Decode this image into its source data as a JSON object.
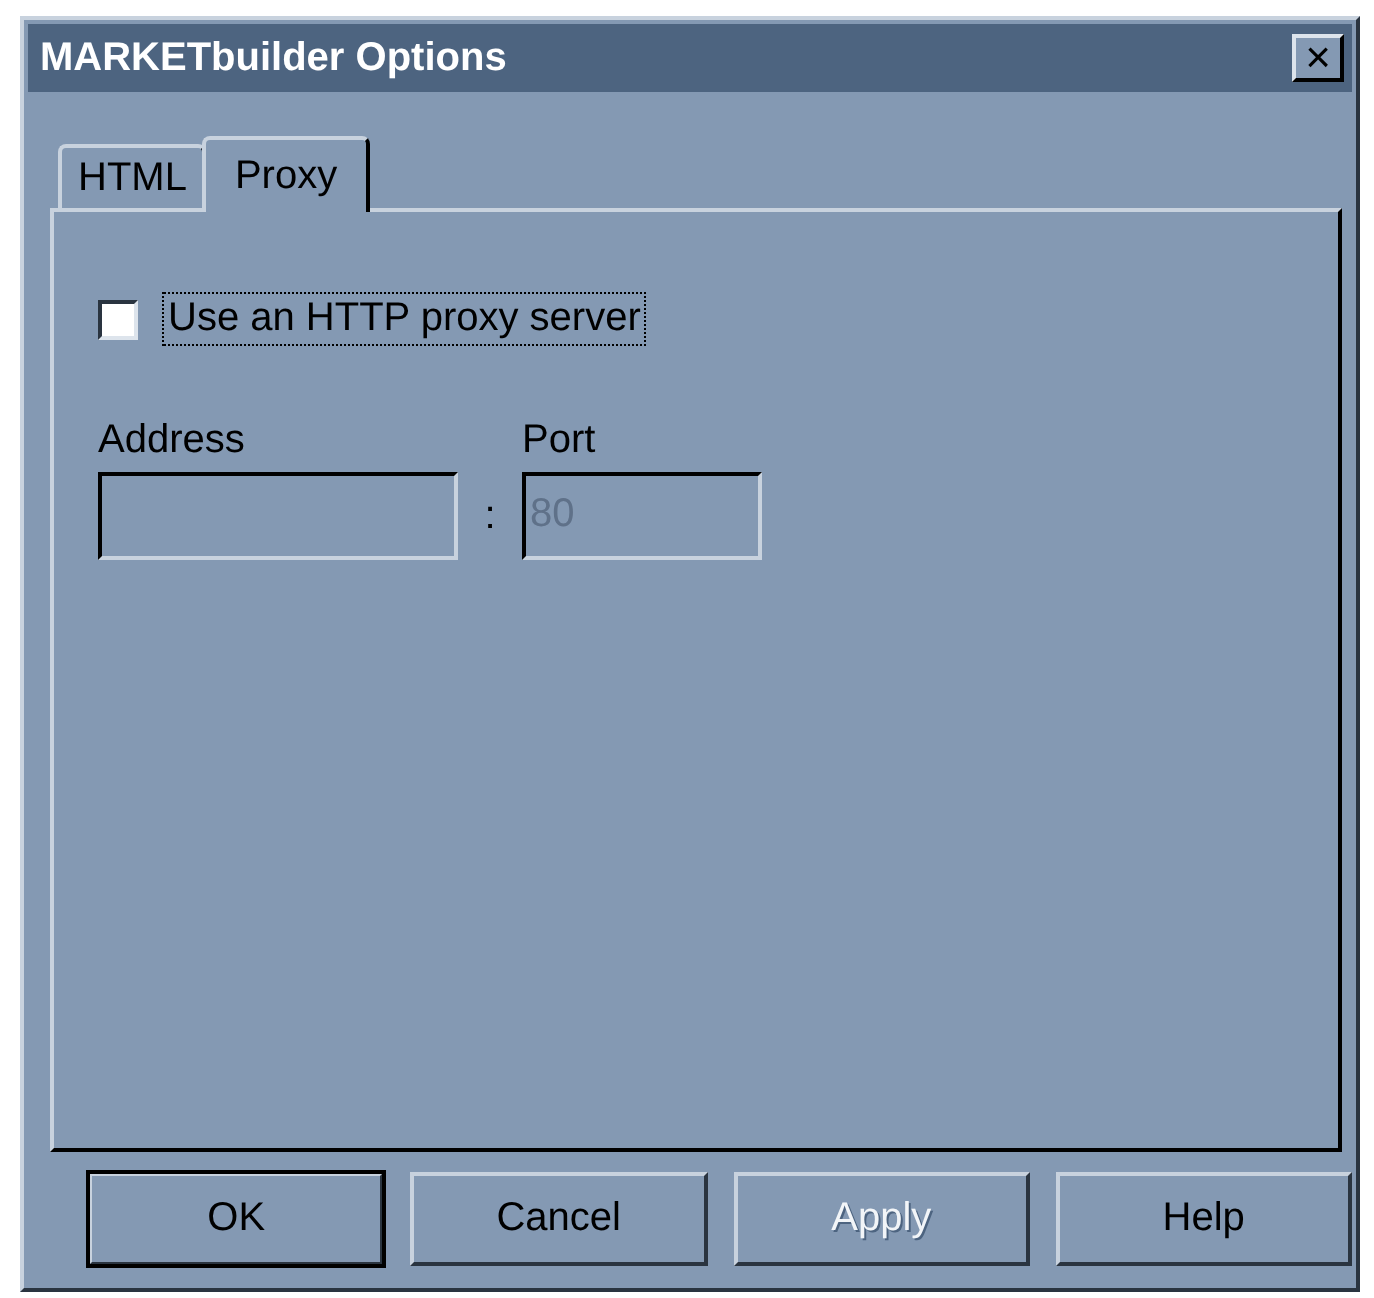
{
  "window": {
    "title": "MARKETbuilder Options",
    "close": "×"
  },
  "tabs": [
    {
      "label": "HTML",
      "selected": false
    },
    {
      "label": "Proxy",
      "selected": true
    }
  ],
  "proxy_checkbox": {
    "label": "Use an HTTP proxy server",
    "checked": false,
    "focused": true
  },
  "address": {
    "label": "Address",
    "disabled": true
  },
  "separator": ":",
  "port": {
    "label": "Port",
    "value": "80",
    "disabled": true
  },
  "buttons": [
    {
      "label": "OK",
      "default": true,
      "disabled": false
    },
    {
      "label": "Cancel",
      "default": false,
      "disabled": false
    },
    {
      "label": "Apply",
      "default": false,
      "disabled": true
    },
    {
      "label": "Help",
      "default": false,
      "disabled": false
    }
  ]
}
